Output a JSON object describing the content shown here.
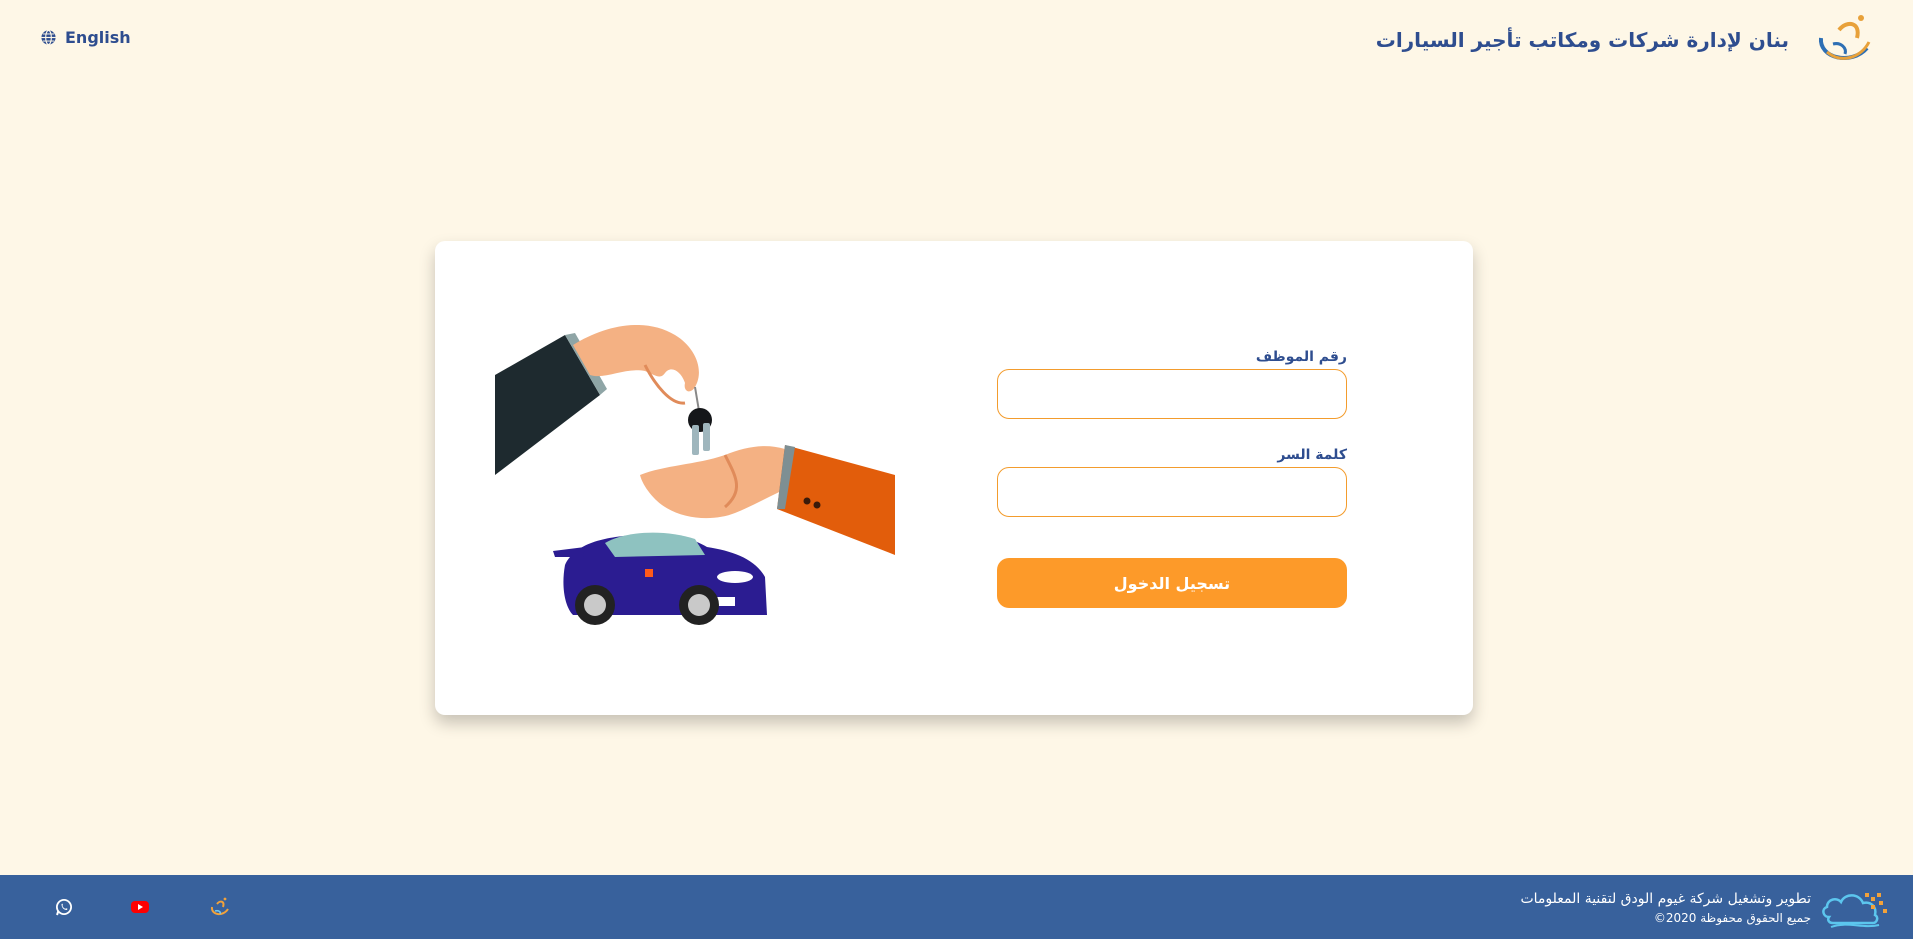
{
  "header": {
    "brand_title": "بنان لإدارة شركات ومكاتب تأجير السيارات",
    "brand_logo_icon": "banan-logo-icon",
    "language_label": "English",
    "language_icon": "globe-icon"
  },
  "login": {
    "employee_id_label": "رقم الموظف",
    "employee_id_value": "",
    "password_label": "كلمة السر",
    "password_value": "",
    "submit_label": "تسجيل الدخول",
    "illustration_icon": "car-keys-handover-illustration"
  },
  "footer": {
    "line1": "تطوير وتشغيل شركة غيوم الودق لتقنية المعلومات",
    "line2": "جميع الحقوق محفوظة 2020©",
    "company_logo_icon": "ghuyoom-alwadq-logo-icon",
    "social": [
      "banan-icon",
      "youtube-icon",
      "whatsapp-icon"
    ]
  },
  "colors": {
    "background": "#fef7e7",
    "primary_text": "#2e4d8f",
    "accent": "#fd9a29",
    "footer": "#38619c"
  }
}
